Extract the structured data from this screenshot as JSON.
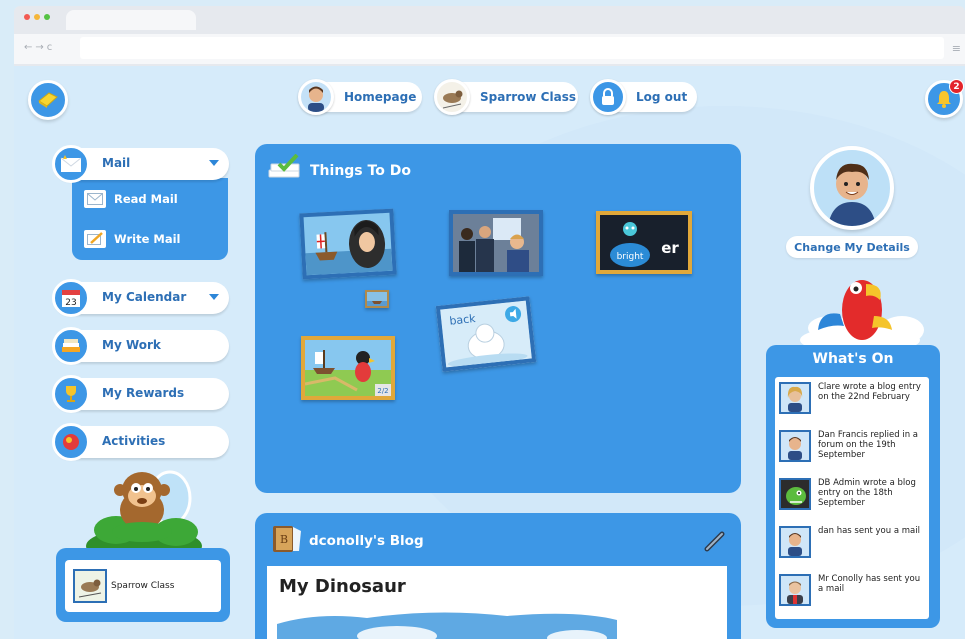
{
  "nav": {
    "homepage": "Homepage",
    "class": "Sparrow Class",
    "logout": "Log out",
    "notification_count": "2"
  },
  "menu": {
    "mail": "Mail",
    "read_mail": "Read Mail",
    "write_mail": "Write Mail",
    "calendar": "My Calendar",
    "calendar_day": "23",
    "work": "My Work",
    "rewards": "My Rewards",
    "activities": "Activities"
  },
  "class_box": {
    "label": "Sparrow Class"
  },
  "todo": {
    "title": "Things To Do",
    "tiles": [
      {
        "name": "columbus-explorer"
      },
      {
        "name": "classroom-video"
      },
      {
        "name": "phonics-bright-er",
        "words": [
          "bright",
          "er"
        ]
      },
      {
        "name": "small-ship-thumbnail"
      },
      {
        "name": "phonics-back-yeti",
        "word": "back"
      },
      {
        "name": "pirate-ship-map",
        "counter": "2/2"
      }
    ]
  },
  "blog": {
    "title": "dconolly's Blog",
    "post_title": "My Dinosaur"
  },
  "profile": {
    "change_details": "Change My Details"
  },
  "whats_on": {
    "title": "What's On",
    "items": [
      {
        "text": "Clare wrote a blog entry on the 22nd February",
        "avatar": "girl-avatar"
      },
      {
        "text": "Dan Francis replied in a forum on the 19th September",
        "avatar": "boy-avatar"
      },
      {
        "text": "DB Admin wrote a blog entry on the 18th September",
        "avatar": "dinosaur-avatar"
      },
      {
        "text": "dan has sent you a mail",
        "avatar": "boy-avatar"
      },
      {
        "text": "Mr Conolly has sent you a mail",
        "avatar": "teacher-avatar"
      }
    ]
  },
  "colors": {
    "panel_blue": "#3d97e6",
    "text_blue": "#2d6fb5",
    "page_bg": "#d6ebfa",
    "badge_red": "#e3242b"
  }
}
